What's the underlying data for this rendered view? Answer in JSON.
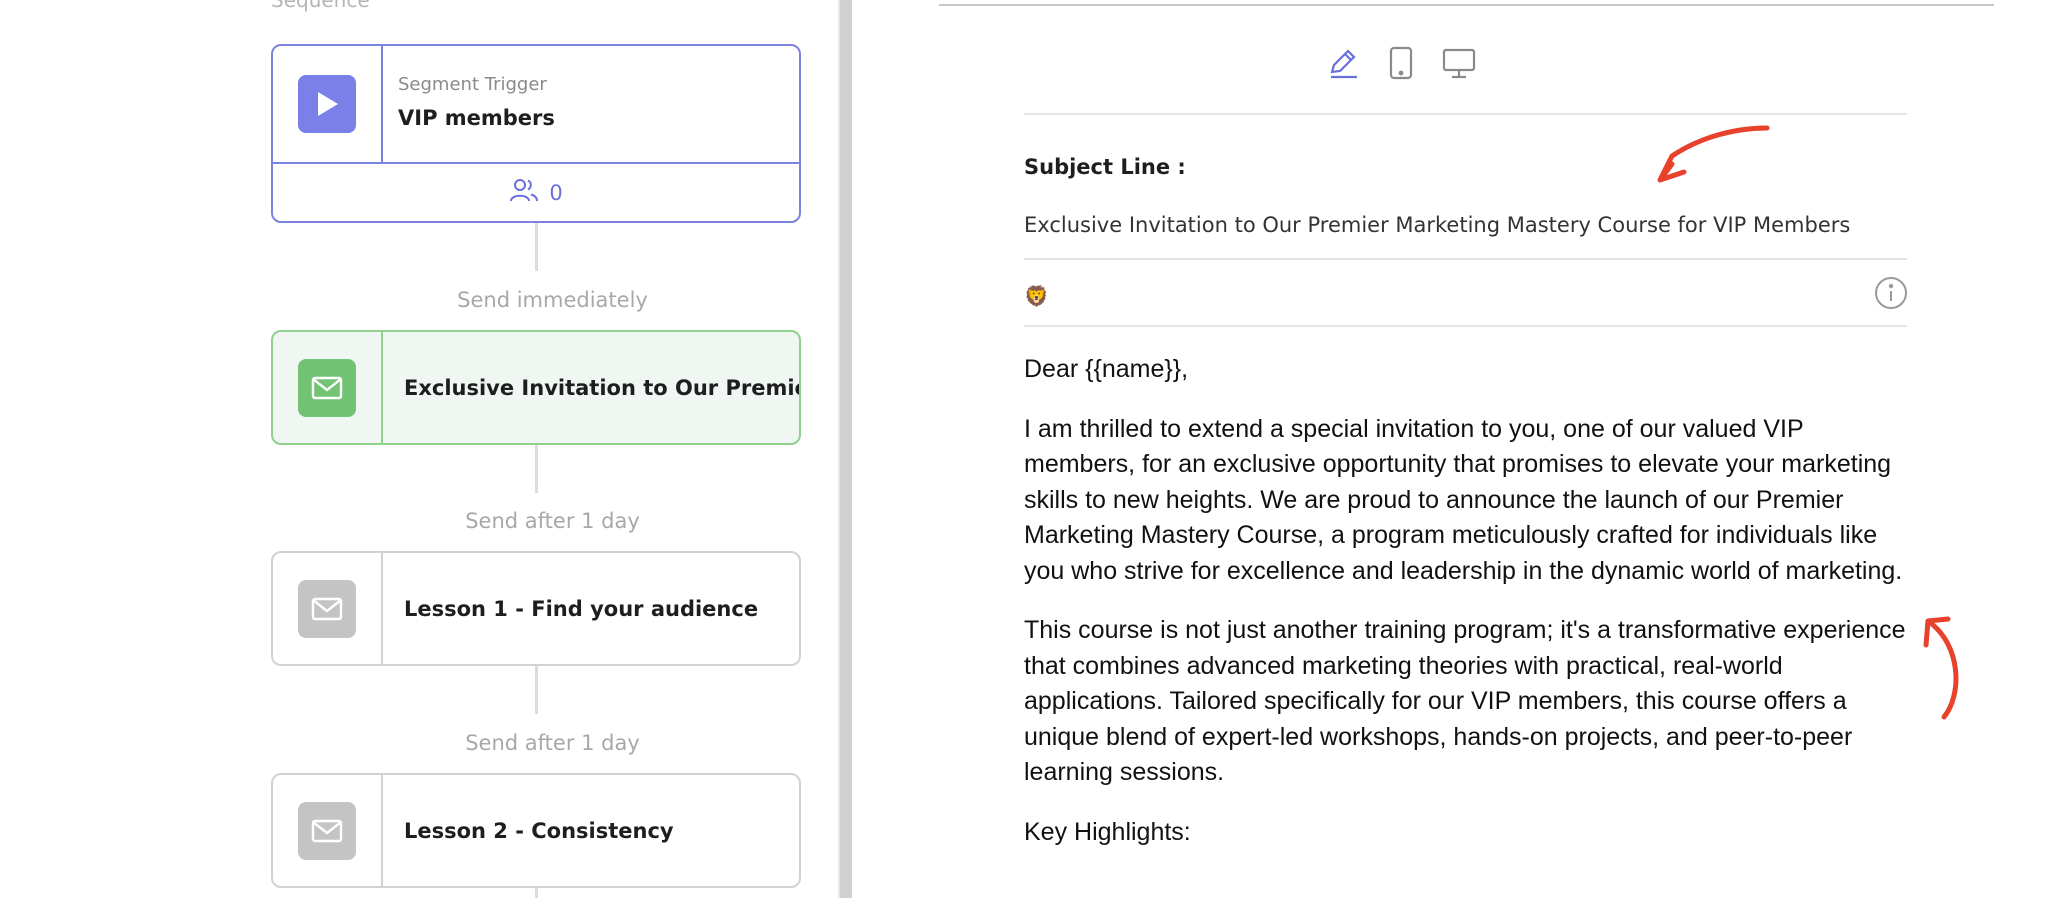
{
  "sequence": {
    "label": "Sequence",
    "trigger": {
      "type_label": "Segment Trigger",
      "name": "VIP members",
      "member_count": "0"
    },
    "delays": [
      "Send immediately",
      "Send after 1 day",
      "Send after 1 day"
    ],
    "emails": [
      {
        "title": "Exclusive Invitation to Our Premier...",
        "state": "active"
      },
      {
        "title": "Lesson 1 - Find your audience",
        "state": "inactive"
      },
      {
        "title": "Lesson 2 - Consistency",
        "state": "inactive"
      }
    ]
  },
  "editor": {
    "view_icons": [
      "pencil-icon",
      "mobile-icon",
      "desktop-icon"
    ],
    "subject_label": "Subject Line :",
    "subject_value": "Exclusive Invitation to Our Premier Marketing Mastery Course for VIP Members",
    "preheader_emoji": "🦁",
    "body": {
      "greeting": "Dear {{name}},",
      "paragraph_1": "I am thrilled to extend a special invitation to you, one of our valued VIP members, for an exclusive opportunity that promises to elevate your marketing skills to new heights. We are proud to announce the launch of our Premier Marketing Mastery Course, a program meticulously crafted for individuals like you who strive for excellence and leadership in the dynamic world of marketing.",
      "paragraph_2": "This course is not just another training program; it's a transformative experience that combines advanced marketing theories with practical, real-world applications. Tailored specifically for our VIP members, this course offers a unique blend of expert-led workshops, hands-on projects, and peer-to-peer learning sessions.",
      "key_highlights": "Key Highlights:"
    }
  },
  "colors": {
    "accent": "#7b7fe8",
    "active_green": "#72c474",
    "annotation_red": "#e8412c"
  }
}
